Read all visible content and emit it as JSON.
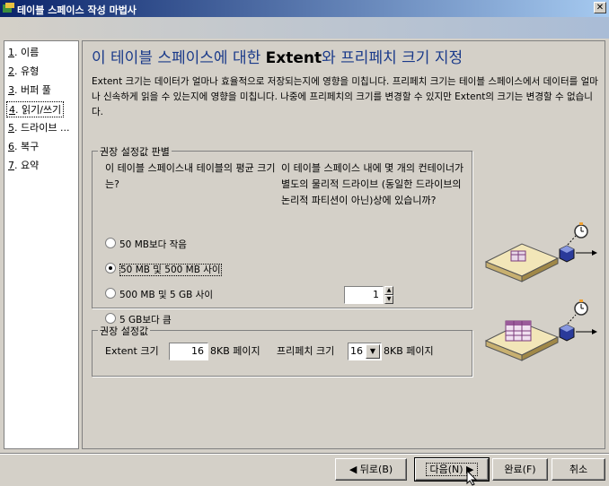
{
  "window": {
    "title": "테이블 스페이스 작성 마법사",
    "close_glyph": "✕"
  },
  "nav": {
    "items": [
      {
        "num": "1",
        "label": ". 이름"
      },
      {
        "num": "2",
        "label": ". 유형"
      },
      {
        "num": "3",
        "label": ". 버퍼 풀"
      },
      {
        "num": "4",
        "label": ". 읽기/쓰기"
      },
      {
        "num": "5",
        "label": ". 드라이브 ..."
      },
      {
        "num": "6",
        "label": ". 복구"
      },
      {
        "num": "7",
        "label": ". 요약"
      }
    ],
    "selected_index": 3
  },
  "main": {
    "title_pre": "이 테이블 스페이스에 대한 ",
    "title_bold": "Extent",
    "title_post": "와 프리페치 크기 지정",
    "description": "Extent 크기는 데이터가 얼마나 효율적으로 저장되는지에 영향을 미칩니다. 프리페치 크기는 테이블 스페이스에서 데이터를 얼마나 신속하게 읽을 수 있는지에 영향을 미칩니다. 나중에 프리페치의 크기를 변경할 수 있지만 Extent의 크기는 변경할 수 없습니다."
  },
  "recommend_group": {
    "legend": "권장 설정값 판별",
    "question_left": "이 테이블 스페이스내 테이블의 평균 크기는?",
    "question_right": "이 테이블 스페이스 내에 몇 개의 컨테이너가 별도의 물리적 드라이브 (동일한 드라이브의 논리적 파티션이 아닌)상에 있습니까?",
    "options": [
      "50 MB보다 작음",
      "50 MB 및 500 MB 사이",
      "500 MB 및 5 GB 사이",
      "5 GB보다 큼"
    ],
    "selected_option": 1,
    "containers_value": "1"
  },
  "settings_group": {
    "legend": "권장 설정값",
    "extent_label": "Extent 크기",
    "extent_value": "16",
    "extent_unit": "8KB 페이지",
    "prefetch_label": "프리페치 크기",
    "prefetch_value": "16",
    "prefetch_unit": "8KB 페이지"
  },
  "buttons": {
    "back": "◀ 뒤로(B)",
    "next": "다음(N) ▶",
    "finish": "완료(F)",
    "cancel": "취소"
  },
  "icons": {
    "dropdown": "▼",
    "spin_up": "▲",
    "spin_down": "▼"
  }
}
